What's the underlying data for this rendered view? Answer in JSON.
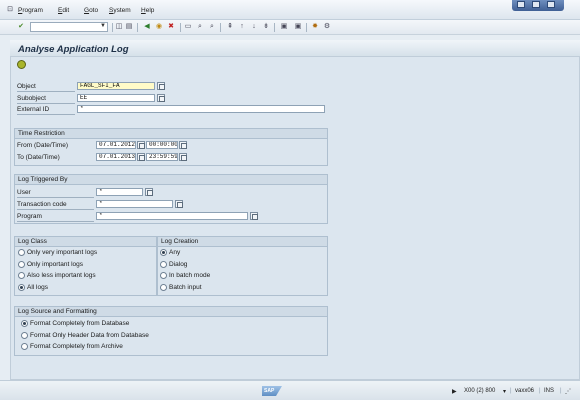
{
  "menu": {
    "items": [
      {
        "key": "P",
        "rest": "rogram"
      },
      {
        "key": "E",
        "rest": "dit"
      },
      {
        "key": "G",
        "rest": "oto"
      },
      {
        "key": "S",
        "rest": "ystem"
      },
      {
        "key": "H",
        "rest": "elp"
      }
    ]
  },
  "toolbar": {
    "command_value": "",
    "icons": [
      "enter-icon",
      "save-icon",
      "back-icon",
      "exit-icon",
      "cancel-icon",
      "print-icon",
      "find-icon",
      "find-next-icon",
      "first-page-icon",
      "prev-page-icon",
      "next-page-icon",
      "last-page-icon",
      "new-session-icon",
      "shortcut-icon",
      "help-icon",
      "customize-icon"
    ]
  },
  "page": {
    "title": "Analyse Application Log"
  },
  "fields": {
    "object_label": "Object",
    "object_value": "FAGL_SFI_FA",
    "subobject_label": "Subobject",
    "subobject_value": "EE",
    "external_id_label": "External ID",
    "external_id_value": "*"
  },
  "time_restriction": {
    "title": "Time Restriction",
    "from_label": "From (Date/Time)",
    "from_date": "07.01.2012",
    "from_time": "00:00:00",
    "to_label": "To (Date/Time)",
    "to_date": "07.01.2013",
    "to_time": "23:59:59"
  },
  "triggered_by": {
    "title": "Log Triggered By",
    "user_label": "User",
    "user_value": "*",
    "tcode_label": "Transaction code",
    "tcode_value": "*",
    "program_label": "Program",
    "program_value": "*"
  },
  "log_class": {
    "title": "Log Class",
    "options": [
      "Only very important logs",
      "Only important logs",
      "Also less important logs",
      "All logs"
    ],
    "selected": 3
  },
  "log_creation": {
    "title": "Log Creation",
    "options": [
      "Any",
      "Dialog",
      "In batch mode",
      "Batch input"
    ],
    "selected": 0
  },
  "log_source": {
    "title": "Log Source and Formatting",
    "options": [
      "Format Completely from Database",
      "Format Only Header Data from Database",
      "Format Completely from Archive"
    ],
    "selected": 0
  },
  "status": {
    "system": "X00 (2) 800",
    "server": "vaxx06",
    "mode": "INS"
  }
}
